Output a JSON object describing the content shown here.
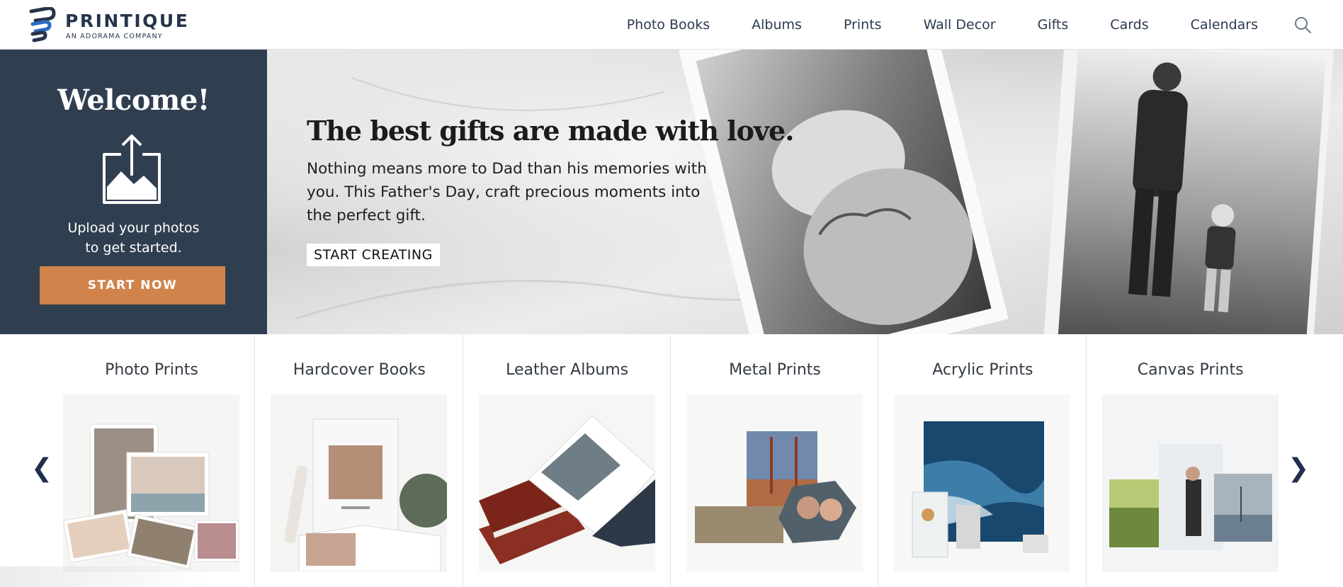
{
  "header": {
    "logo_name": "PRINTIQUE",
    "logo_tagline": "AN ADORAMA COMPANY",
    "nav": [
      {
        "label": "Photo Books"
      },
      {
        "label": "Albums"
      },
      {
        "label": "Prints"
      },
      {
        "label": "Wall Decor"
      },
      {
        "label": "Gifts"
      },
      {
        "label": "Cards"
      },
      {
        "label": "Calendars"
      }
    ],
    "search_icon": "search-icon"
  },
  "welcome": {
    "title": "Welcome!",
    "icon": "upload-photo-icon",
    "text_line1": "Upload your photos",
    "text_line2": "to get started.",
    "button_label": "START NOW"
  },
  "banner": {
    "headline": "The best gifts are made with love.",
    "body": "Nothing means more to Dad than his memories with you. This Father's Day, craft precious moments into the perfect gift.",
    "button_label": "START CREATING"
  },
  "carousel": {
    "prev_icon": "chevron-left-icon",
    "next_icon": "chevron-right-icon",
    "prev_glyph": "❮",
    "next_glyph": "❯",
    "items": [
      {
        "title": "Photo Prints"
      },
      {
        "title": "Hardcover Books"
      },
      {
        "title": "Leather Albums"
      },
      {
        "title": "Metal Prints"
      },
      {
        "title": "Acrylic Prints"
      },
      {
        "title": "Canvas Prints"
      }
    ]
  },
  "colors": {
    "navy_panel": "#303f50",
    "accent_orange": "#d0844c",
    "nav_text": "#2c3a50"
  }
}
